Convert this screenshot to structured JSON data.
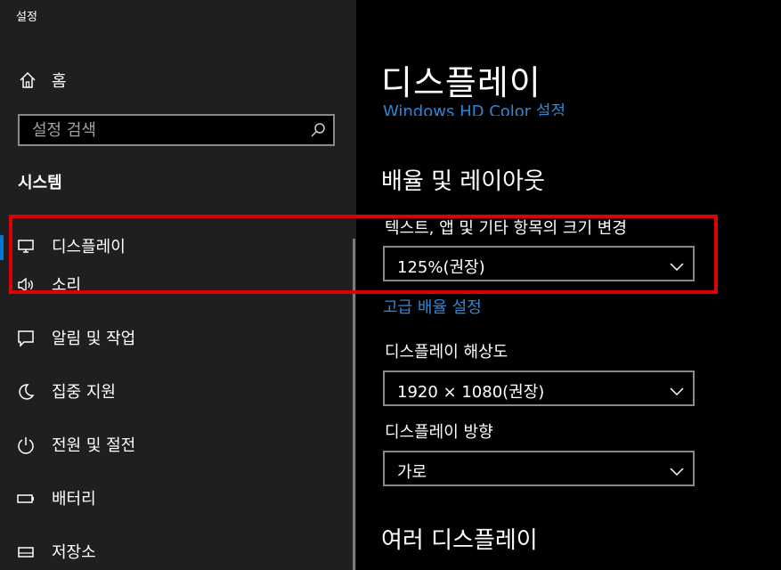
{
  "app": {
    "title": "설정"
  },
  "sidebar": {
    "home_label": "홈",
    "search_placeholder": "설정 검색",
    "section_heading": "시스템",
    "items": [
      {
        "label": "디스플레이",
        "icon": "monitor-icon",
        "active": true
      },
      {
        "label": "소리",
        "icon": "speaker-icon"
      },
      {
        "label": "알림 및 작업",
        "icon": "notification-icon"
      },
      {
        "label": "집중 지원",
        "icon": "moon-icon"
      },
      {
        "label": "전원 및 절전",
        "icon": "power-icon"
      },
      {
        "label": "배터리",
        "icon": "battery-icon"
      },
      {
        "label": "저장소",
        "icon": "storage-icon"
      }
    ]
  },
  "main": {
    "title": "디스플레이",
    "hd_color_link": "Windows HD Color 설정",
    "scale_section": {
      "heading": "배율 및 레이아웃",
      "scale_label": "텍스트, 앱 및 기타 항목의 크기 변경",
      "scale_value": "125%(권장)",
      "advanced_link": "고급 배율 설정",
      "resolution_label": "디스플레이 해상도",
      "resolution_value": "1920 × 1080(권장)",
      "orientation_label": "디스플레이 방향",
      "orientation_value": "가로"
    },
    "multi_display_heading": "여러 디스플레이"
  },
  "colors": {
    "accent": "#0078d7",
    "link": "#2b88d8",
    "highlight": "#e00000"
  }
}
